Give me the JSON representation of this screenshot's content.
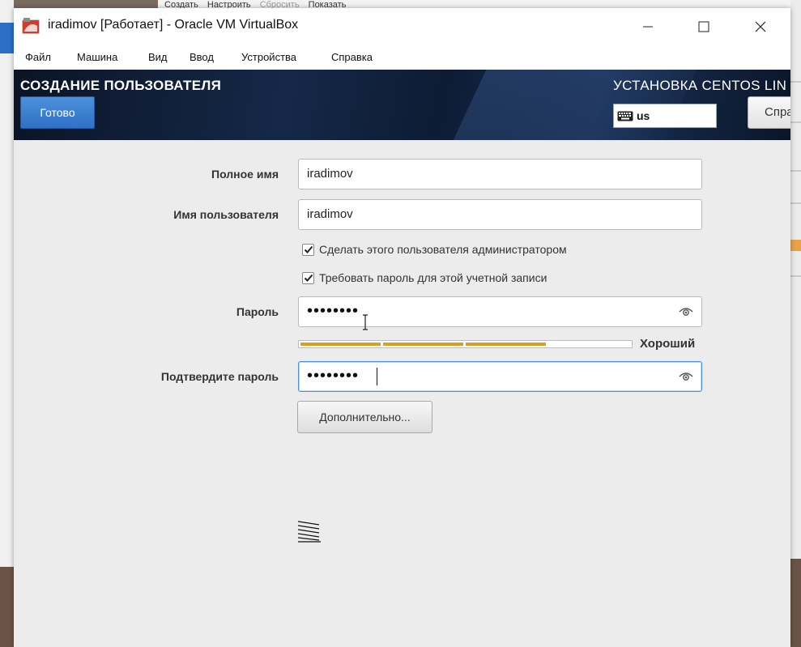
{
  "host": {
    "toolbar": [
      "Создать",
      "Настроить",
      "Сбросить",
      "Показать"
    ]
  },
  "window": {
    "title": "iradimov [Работает] - Oracle VM VirtualBox",
    "menu": [
      "Файл",
      "Машина",
      "Вид",
      "Ввод",
      "Устройства",
      "Справка"
    ]
  },
  "header": {
    "spoke_title": "СОЗДАНИЕ ПОЛЬЗОВАТЕЛЯ",
    "done_label": "Готово",
    "install_title": "УСТАНОВКА CENTOS LIN",
    "keyboard_layout": "us",
    "help_label": "Спра"
  },
  "form": {
    "fullname_label": "Полное имя",
    "fullname_value": "iradimov",
    "username_label": "Имя пользователя",
    "username_value": "iradimov",
    "admin_checkbox_label": "Сделать этого пользователя администратором",
    "admin_checked": true,
    "require_password_label": "Требовать пароль для этой учетной записи",
    "require_password_checked": true,
    "password_label": "Пароль",
    "password_mask": "••••••••",
    "strength_text": "Хороший",
    "strength_level": 0.75,
    "confirm_label": "Подтвердите пароль",
    "confirm_mask": "••••••••",
    "advanced_label": "Дополнительно..."
  },
  "colors": {
    "accent": "#2f71c4",
    "strength": "#d8a023"
  },
  "icons": [
    "app-icon",
    "minimize-icon",
    "maximize-icon",
    "close-icon",
    "keyboard-icon",
    "eye-icon",
    "checkmark-icon",
    "busy-icon",
    "ibeam-cursor-icon"
  ]
}
